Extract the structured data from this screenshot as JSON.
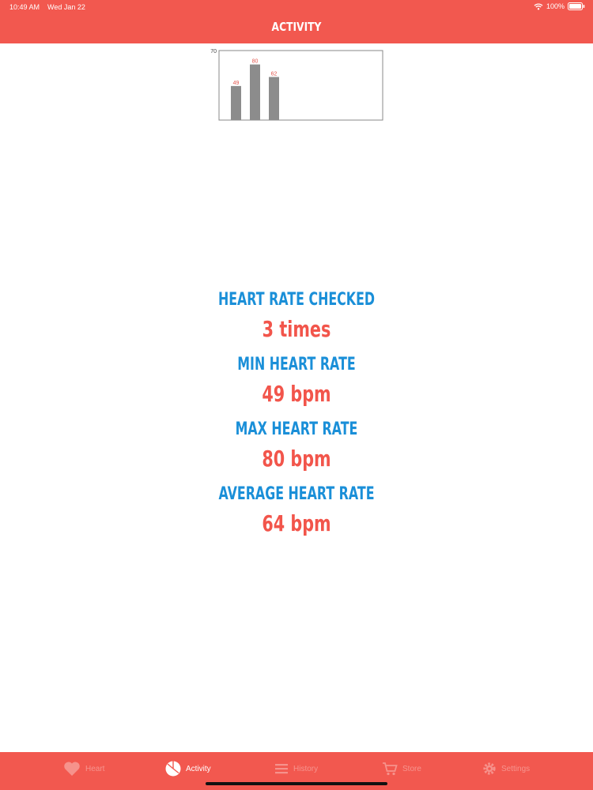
{
  "status_bar": {
    "time": "10:49 AM",
    "date": "Wed Jan 22",
    "battery": "100%"
  },
  "header": {
    "title": "ACTIVITY"
  },
  "chart_data": {
    "type": "bar",
    "categories": [
      "",
      "",
      ""
    ],
    "values": [
      49,
      80,
      62
    ],
    "data_labels": [
      "49",
      "80",
      "62"
    ],
    "y_tick_labels": [
      "70"
    ],
    "title": "",
    "xlabel": "",
    "ylabel": "",
    "ylim": [
      0,
      100
    ],
    "grid": false,
    "colors": {
      "bar": "#8c8c8c",
      "label": "#e2564d",
      "frame": "#888888"
    }
  },
  "stats": [
    {
      "label": "HEART RATE CHECKED",
      "value": "3 times"
    },
    {
      "label": "MIN HEART RATE",
      "value": "49 bpm"
    },
    {
      "label": "MAX HEART RATE",
      "value": "80 bpm"
    },
    {
      "label": "AVERAGE HEART RATE",
      "value": "64 bpm"
    }
  ],
  "tabbar": {
    "items": [
      {
        "label": "Heart",
        "icon": "heart-icon",
        "active": false
      },
      {
        "label": "Activity",
        "icon": "pie-chart-icon",
        "active": true
      },
      {
        "label": "History",
        "icon": "list-icon",
        "active": false
      },
      {
        "label": "Store",
        "icon": "cart-icon",
        "active": false
      },
      {
        "label": "Settings",
        "icon": "gear-icon",
        "active": false
      }
    ]
  },
  "colors": {
    "accent": "#f2584f",
    "label_blue": "#1a8fd8",
    "value_red": "#f2554b"
  }
}
